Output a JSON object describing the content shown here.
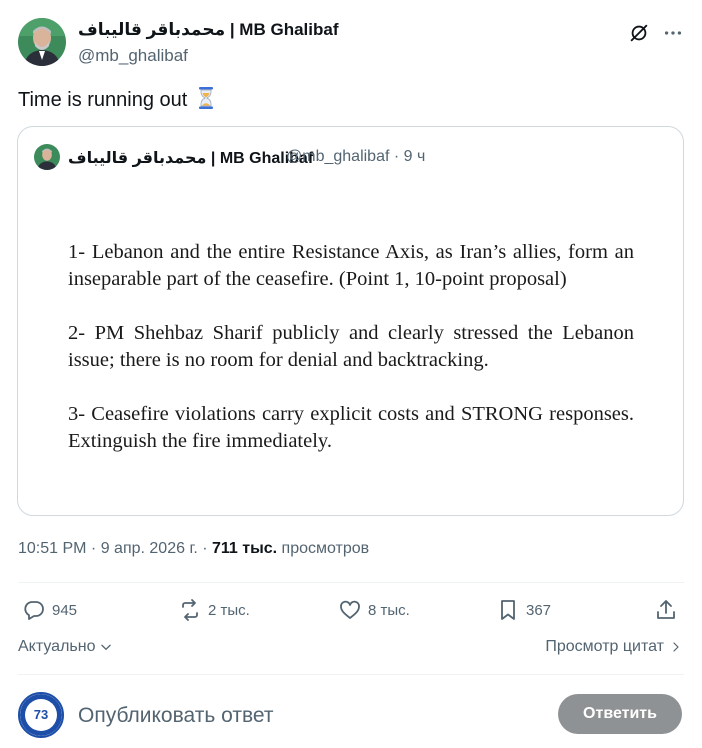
{
  "author": {
    "display_name": "محمدباقر قالیباف | MB Ghalibaf",
    "handle": "@mb_ghalibaf"
  },
  "tweet": {
    "text": "Time is running out",
    "emoji": "hourglass-icon"
  },
  "quote": {
    "display_name": "محمدباقر قالیباف | MB Ghalibaf",
    "handle_time": "@mb_ghalibaf · 9 ч",
    "paragraphs": [
      "1- Lebanon and the entire Resistance Axis, as Iran’s allies, form an inseparable part of the ceasefire. (Point 1, 10-point proposal)",
      "2- PM Shehbaz Sharif publicly and clearly stressed the Lebanon issue; there is no room for denial and backtracking.",
      "3- Ceasefire violations carry explicit costs and STRONG responses. Extinguish the fire immediately."
    ]
  },
  "meta": {
    "timestamp": "10:51 PM · 9 апр. 2026 г. · ",
    "views_count": "711 тыс.",
    "views_label": " просмотров"
  },
  "actions": {
    "replies": "945",
    "reposts": "2 тыс.",
    "likes": "8 тыс.",
    "bookmarks": "367"
  },
  "sort_label": "Актуально",
  "quotes_link": "Просмотр цитат",
  "reply": {
    "placeholder": "Опубликовать ответ",
    "button": "Ответить",
    "avatar_text": "73"
  },
  "colors": {
    "text": "#0f1419",
    "secondary": "#536471",
    "border": "#cfd9de",
    "button_disabled": "#8f9294"
  }
}
